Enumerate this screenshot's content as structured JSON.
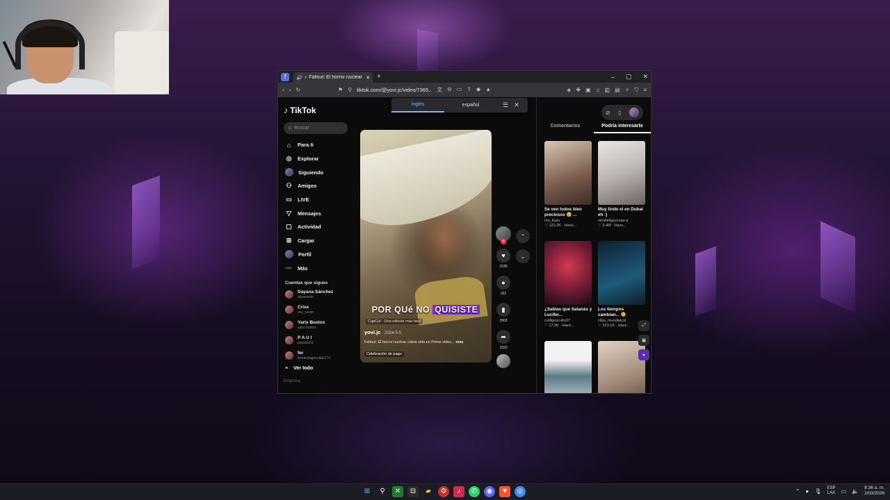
{
  "browser": {
    "tab_title": "Fallout: El horror nuclear cobra",
    "url": "tiktok.com/@yovi.jc/video/7365...",
    "new_tab": "+",
    "window_controls": [
      "–",
      "▢",
      "✕"
    ]
  },
  "translate": {
    "lang_source": "inglés",
    "lang_target": "español",
    "menu_icon": "☰",
    "close_icon": "✕"
  },
  "sidebar": {
    "logo": "TikTok",
    "search_placeholder": "Buscar",
    "nav": [
      {
        "label": "Para ti",
        "icon": "⌂"
      },
      {
        "label": "Explorar",
        "icon": "◎"
      },
      {
        "label": "Siguiendo",
        "icon": "avatar"
      },
      {
        "label": "Amigos",
        "icon": "⚇"
      },
      {
        "label": "LIVE",
        "icon": "▭"
      },
      {
        "label": "Mensajes",
        "icon": "▽"
      },
      {
        "label": "Actividad",
        "icon": "▢"
      },
      {
        "label": "Cargar",
        "icon": "⊞"
      },
      {
        "label": "Perfil",
        "icon": "avatar"
      },
      {
        "label": "Más",
        "icon": "···"
      }
    ],
    "following_title": "Cuentas que sigues",
    "accounts": [
      {
        "name": "Dayana Sánchez",
        "handle": "dayaneslo"
      },
      {
        "name": "Criss",
        "handle": "cris_raven"
      },
      {
        "name": "Yaris Bustos",
        "handle": "yaris.bustos"
      },
      {
        "name": "P A U I",
        "handle": "paulaxx01"
      },
      {
        "name": "fer",
        "handle": "fernandagonzalet174"
      }
    ],
    "see_all": "Ver todo",
    "company": "Empresa"
  },
  "video": {
    "caption_a": "POR QUé NO",
    "caption_b": "QUISISTE",
    "capcut": "CapCut · Una edición más fácil",
    "user": "yovi.jc",
    "date": "· 2024-5-5",
    "description": "Fallout: El horror nuclear cobra vida en Prime video...",
    "more": "más",
    "music": "Celebración de pago"
  },
  "actions": {
    "likes": "153K",
    "comments": "322",
    "saves": "2903",
    "shares": "1592"
  },
  "right_panel": {
    "tab_comments": "Comentarios",
    "tab_interest": "Podría interesarte",
    "cards": [
      {
        "title": "Se ven todos bien preciosos 🥹 ...",
        "user": "ma_kuzu",
        "stats": "♡ 123.3K · Hace..."
      },
      {
        "title": "Muy lindo el en Dubai eh :)",
        "user": "nicollefigueroaa ●",
        "stats": "♡ 3.4M · Hace..."
      },
      {
        "title": "¿Sabías que Satanás y Lucifer...",
        "user": "codigooculto07",
        "stats": "♡ 17.9K · Hace..."
      },
      {
        "title": "Los tiempos cambian... 🫠",
        "user": "clips_mundialcol",
        "stats": "♡ 223.1K · Hace..."
      },
      {
        "title": "",
        "user": "",
        "stats": ""
      },
      {
        "title": "",
        "user": "",
        "stats": ""
      }
    ]
  },
  "taskbar": {
    "lang_top": "ESP",
    "lang_bottom": "LAA",
    "time": "8:36 a. m.",
    "date": "2/03/2026"
  }
}
